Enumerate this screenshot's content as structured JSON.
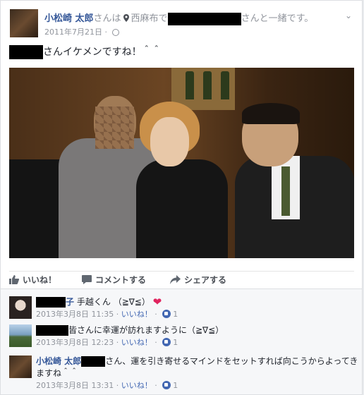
{
  "post": {
    "author": "小松崎 太郎",
    "header_mid": "さんは",
    "location": "西麻布で",
    "header_end": "さんと一緒です。",
    "date": "2011年7月21日",
    "meta_sep": " · ",
    "text_suffix": "さんイケメンですね！＾＾"
  },
  "actions": {
    "like": "いいね！",
    "comment": "コメントする",
    "share": "シェアする"
  },
  "comments": [
    {
      "name_suffix": "子",
      "name_rest": "手越くん",
      "text": "（≧∇≦）",
      "date": "2013年3月8日 11:35",
      "like_link": "いいね！",
      "like_count": "1"
    },
    {
      "text": "皆さんに幸運が訪れますように（≧∇≦）",
      "date": "2013年3月8日 12:23",
      "like_link": "いいね！",
      "like_count": "1"
    },
    {
      "name": "小松崎 太郎",
      "text": "さん、運を引き寄せるマインドをセットすれば向こうからよってきますね＾＾",
      "date": "2013年3月8日 13:31",
      "like_link": "いいね！",
      "like_count": "1"
    }
  ],
  "colors": {
    "link": "#365899",
    "meta": "#90949c",
    "like": "#4267b2",
    "heart": "#e0245e"
  },
  "icons": [
    "location-pin-icon",
    "globe-icon",
    "chevron-down-icon",
    "like-icon",
    "comment-icon",
    "share-icon",
    "heart-icon",
    "like-badge-icon"
  ]
}
